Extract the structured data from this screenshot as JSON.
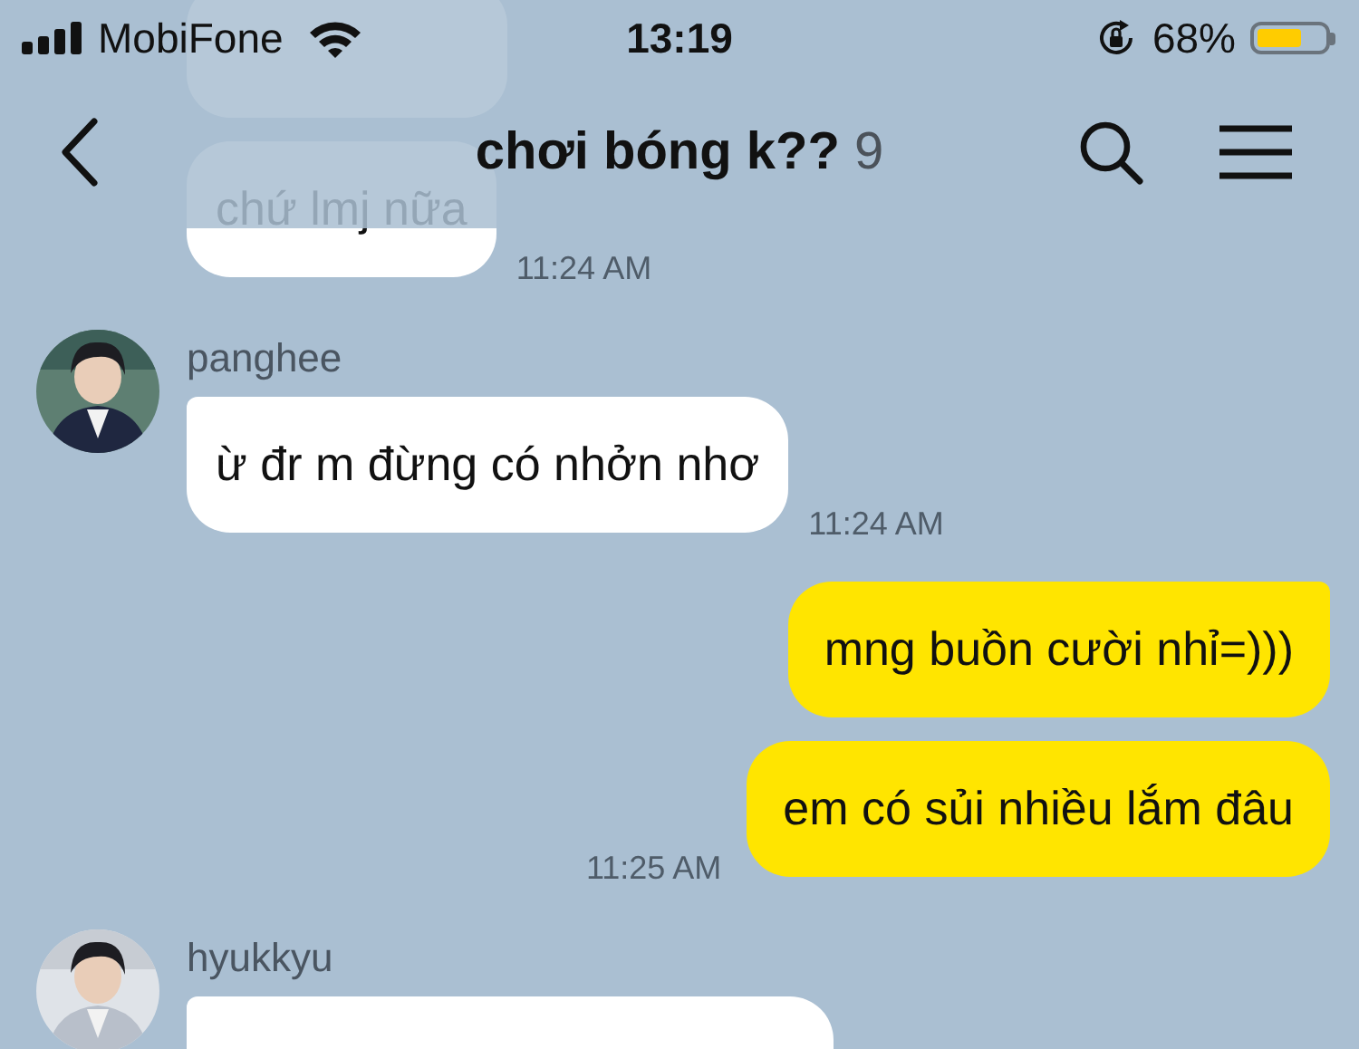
{
  "status_bar": {
    "carrier": "MobiFone",
    "time": "13:19",
    "battery": "68%"
  },
  "header": {
    "title": "chơi bóng k??",
    "count": "9"
  },
  "messages": [
    {
      "kind": "in"
    },
    {
      "kind": "in",
      "text": "chứ lmj nữa",
      "time": "11:24 AM"
    },
    {
      "kind": "in",
      "sender": "panghee",
      "text": "ừ đr m đừng có nhởn nhơ",
      "time": "11:24 AM"
    },
    {
      "kind": "out",
      "text": "mng buồn cười nhỉ=)))"
    },
    {
      "kind": "out",
      "text": "em có sủi nhiều lắm đâu",
      "time": "11:25 AM"
    },
    {
      "kind": "in",
      "sender": "hyukkyu"
    }
  ]
}
